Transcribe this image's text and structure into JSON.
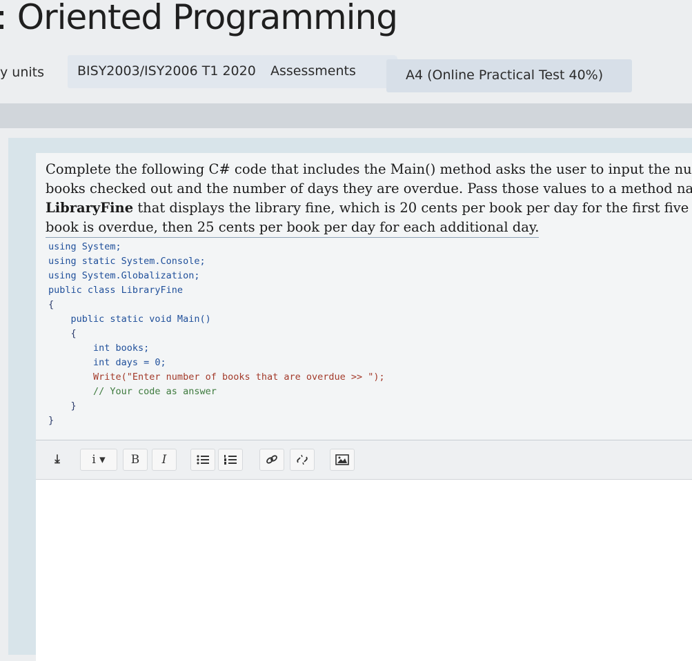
{
  "page": {
    "title": ": Oriented Programming"
  },
  "breadcrumb": {
    "items": [
      {
        "label": "y units"
      },
      {
        "label": "BISY2003/ISY2006 T1 2020"
      },
      {
        "label": "Assessments"
      },
      {
        "label": "A4 (Online Practical Test 40%)"
      }
    ]
  },
  "question": {
    "lines": [
      "Complete the following C# code that includes the Main() method asks the user to input the numbe",
      "books checked out and the number of days they are overdue. Pass those values to a method named",
      "that displays the library fine, which is 20 cents per book per day for the first five day",
      "book is overdue, then 25 cents per book per day for each additional day."
    ],
    "bold_term": "LibraryFine"
  },
  "code": {
    "lines": [
      "using System;",
      "using static System.Console;",
      "using System.Globalization;",
      "public class LibraryFine",
      "{",
      "    public static void Main()",
      "    {",
      "        int books;",
      "        int days = 0;",
      "        Write(\"Enter number of books that are overdue >> \");",
      "        // Your code as answer",
      "    }",
      "}"
    ]
  },
  "toolbar": {
    "items": [
      {
        "name": "collapse-toolbar-icon",
        "label": "⤓"
      },
      {
        "name": "paragraph-style-icon",
        "label": "i ▾"
      },
      {
        "name": "bold-icon",
        "label": "B"
      },
      {
        "name": "italic-icon",
        "label": "I"
      },
      {
        "name": "unordered-list-icon",
        "label": ""
      },
      {
        "name": "ordered-list-icon",
        "label": ""
      },
      {
        "name": "link-icon",
        "label": ""
      },
      {
        "name": "unlink-icon",
        "label": ""
      },
      {
        "name": "image-icon",
        "label": ""
      }
    ]
  },
  "colors": {
    "accent_panel": "#d8e4ea",
    "code_keyword": "#1f4f9a",
    "code_string": "#a33a2a"
  }
}
